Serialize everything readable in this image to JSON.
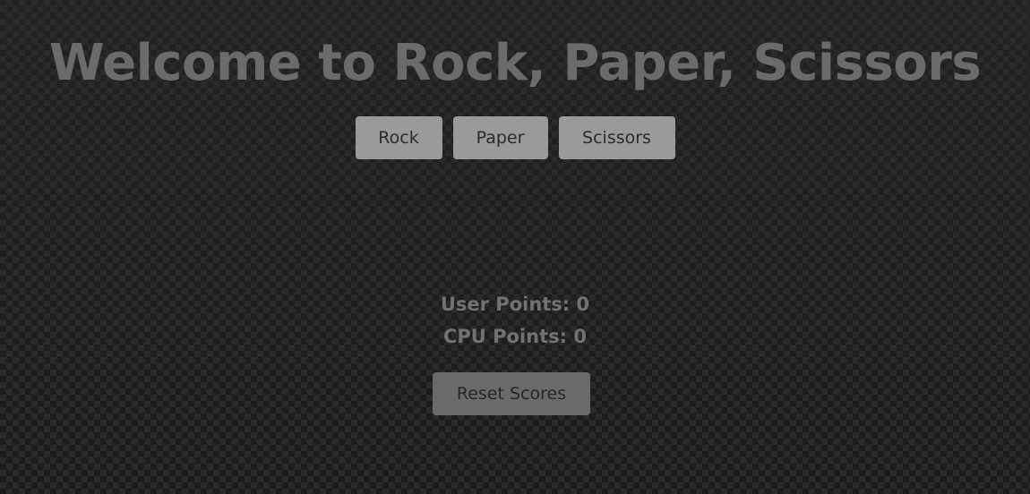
{
  "header": {
    "title": "Welcome to Rock, Paper, Scissors"
  },
  "choices": {
    "rock_label": "Rock",
    "paper_label": "Paper",
    "scissors_label": "Scissors"
  },
  "scores": {
    "user_label": "User Points:",
    "user_points": "0",
    "cpu_label": "CPU Points:",
    "cpu_points": "0"
  },
  "actions": {
    "reset_label": "Reset Scores"
  },
  "colors": {
    "background": "#1f1f1f",
    "text": "#6b6b6b",
    "choice_button": "#9a9a9a",
    "reset_button": "#6a6a6a"
  }
}
